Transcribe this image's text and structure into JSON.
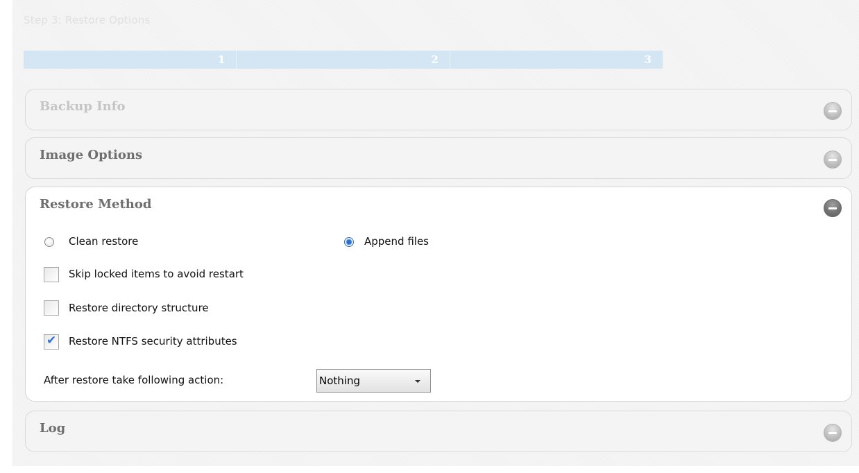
{
  "step_title": "Step 3: Restore Options",
  "progress": {
    "steps": [
      "1",
      "2",
      "3"
    ],
    "current_step": 3
  },
  "panels": {
    "backup_info": {
      "title": "Backup Info",
      "expanded": false
    },
    "image_options": {
      "title": "Image Options",
      "expanded": false
    },
    "restore_method": {
      "title": "Restore Method",
      "expanded": true,
      "options": {
        "clean_restore": {
          "label": "Clean restore",
          "selected": false
        },
        "append_files": {
          "label": "Append files",
          "selected": true
        },
        "skip_locked": {
          "label": "Skip locked items to avoid restart",
          "checked": false
        },
        "restore_dir": {
          "label": "Restore directory structure",
          "checked": false
        },
        "restore_ntfs": {
          "label": "Restore NTFS security attributes",
          "checked": true
        }
      },
      "after_action": {
        "label": "After restore take following action:",
        "value": "Nothing"
      }
    },
    "log": {
      "title": "Log",
      "expanded": false
    }
  },
  "icons": {
    "collapsed": "expand-toggle-icon",
    "expanded": "collapse-toggle-icon",
    "check": "checkmark-icon",
    "dropdown": "chevron-down-icon"
  },
  "colors": {
    "progress_fill": "#d4e6f4",
    "checkmark": "#2f6fd6",
    "radio_selected": "#2a6fd8"
  }
}
